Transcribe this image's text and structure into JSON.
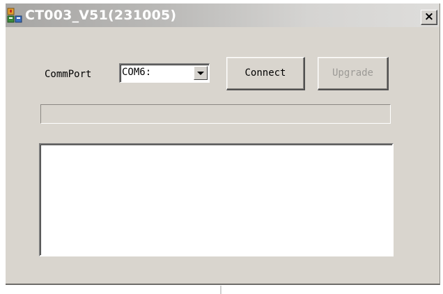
{
  "window": {
    "title": "CT003_V51(231005)",
    "close_glyph": "×",
    "app_icon": "app-icon",
    "close_icon": "close-icon"
  },
  "controls": {
    "commport_label": "CommPort",
    "commport_value": "COM6:",
    "dropdown_icon": "chevron-down-icon",
    "connect_label": "Connect",
    "upgrade_label": "Upgrade",
    "upgrade_enabled": false
  },
  "progress": {
    "value": 0
  },
  "log": {
    "text": ""
  },
  "colors": {
    "window_bg": "#d9d5ce",
    "title_text": "#ffffff",
    "disabled_text": "#9c9a96"
  }
}
